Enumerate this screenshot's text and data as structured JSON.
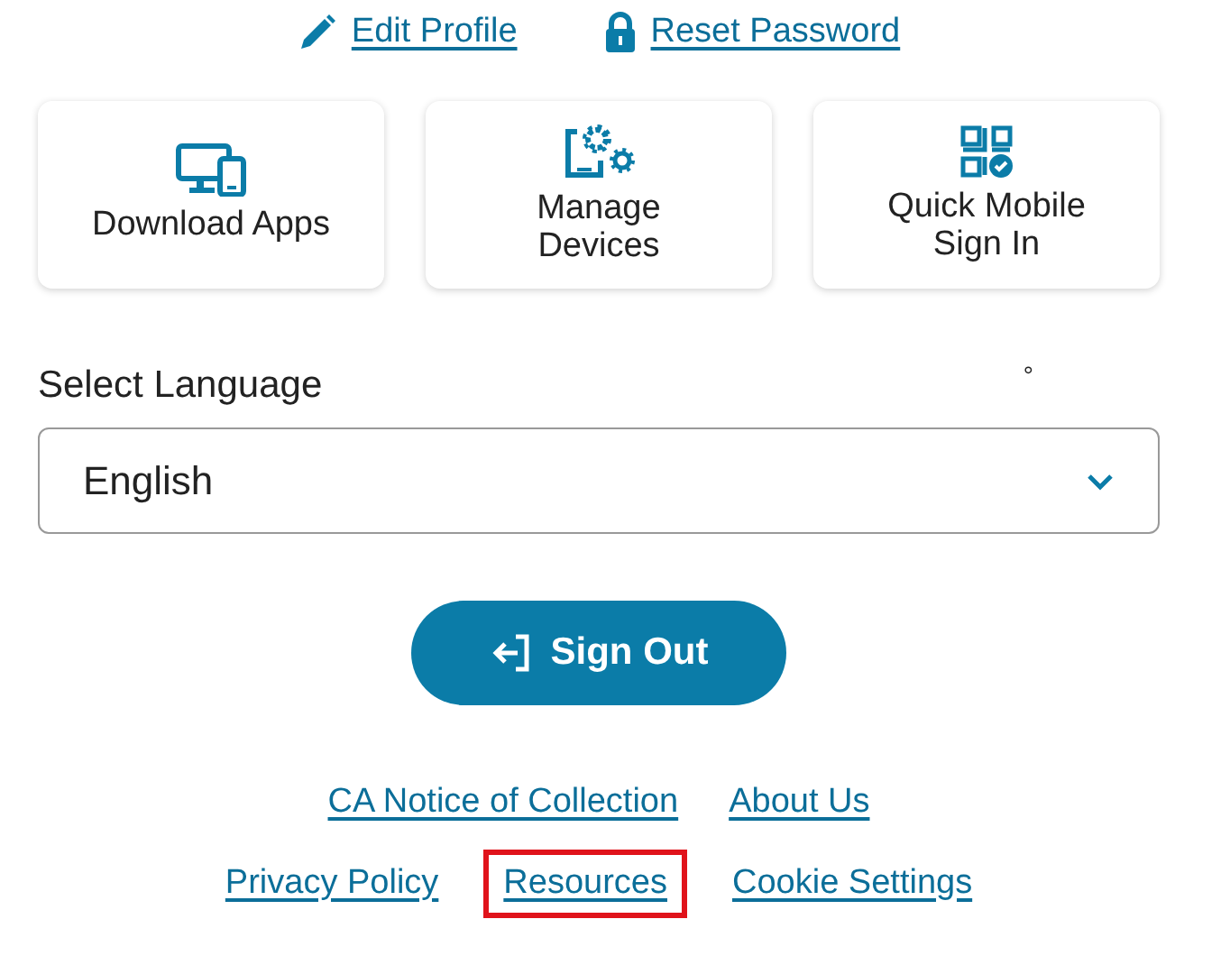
{
  "top_links": [
    {
      "kind": "edit",
      "label": "Edit Profile"
    },
    {
      "kind": "lock",
      "label": "Reset Password"
    }
  ],
  "tiles": [
    {
      "kind": "devices",
      "label": "Download Apps"
    },
    {
      "kind": "manage",
      "label": "Manage Devices"
    },
    {
      "kind": "qr",
      "label": "Quick Mobile Sign In"
    }
  ],
  "language": {
    "label": "Select Language",
    "value": "English",
    "mark": "°"
  },
  "sign_out": {
    "label": "Sign Out"
  },
  "footer_rows": [
    [
      {
        "label": "CA Notice of Collection",
        "highlighted": false
      },
      {
        "label": "About Us",
        "highlighted": false
      }
    ],
    [
      {
        "label": "Privacy Policy",
        "highlighted": false
      },
      {
        "label": "Resources",
        "highlighted": true
      },
      {
        "label": "Cookie Settings",
        "highlighted": false
      }
    ]
  ]
}
